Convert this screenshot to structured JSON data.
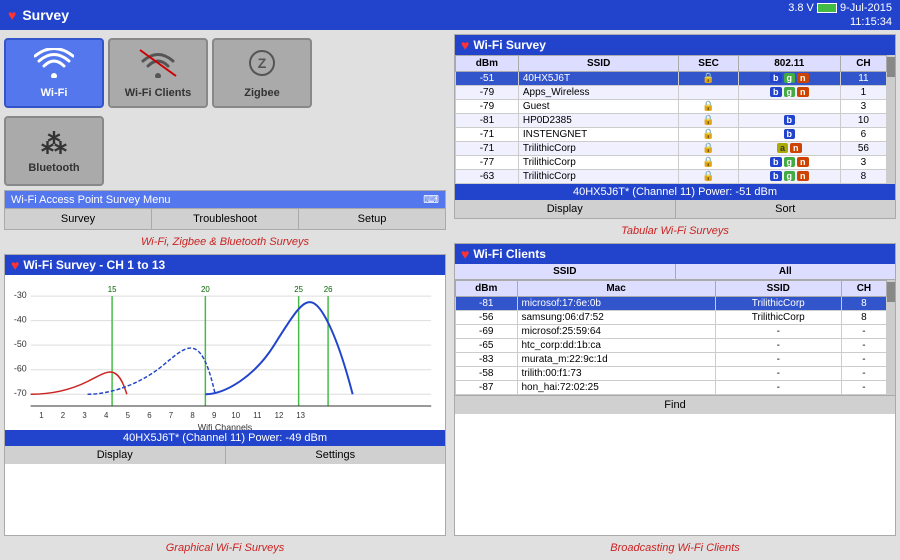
{
  "header": {
    "title": "Survey",
    "voltage": "3.8 V",
    "date": "9-Jul-2015",
    "time": "11:15:34"
  },
  "left_panel": {
    "buttons": [
      {
        "label": "Wi-Fi",
        "icon": "wifi"
      },
      {
        "label": "Wi-Fi Clients",
        "icon": "wifi-clients"
      },
      {
        "label": "Zigbee",
        "icon": "zigbee"
      }
    ],
    "bluetooth_label": "Bluetooth",
    "ap_menu": {
      "title": "Wi-Fi Access Point Survey Menu",
      "survey_btn": "Survey",
      "troubleshoot_btn": "Troubleshoot",
      "setup_btn": "Setup",
      "desc": "Wi-Fi, Zigbee & Bluetooth Surveys"
    },
    "chart": {
      "title": "Wi-Fi Survey - CH 1 to 13",
      "y_labels": [
        "-30",
        "-40",
        "-50",
        "-60",
        "-70"
      ],
      "x_label": "Wifi Channels",
      "x_ticks": [
        "1",
        "2",
        "3",
        "4",
        "5",
        "6",
        "7",
        "8",
        "9",
        "10",
        "11",
        "12",
        "13"
      ],
      "channel_markers": [
        "15",
        "20",
        "25",
        "26"
      ],
      "status_bar": "40HX5J6T* (Channel 11) Power: -49 dBm",
      "display_btn": "Display",
      "settings_btn": "Settings",
      "desc": "Graphical Wi-Fi Surveys"
    }
  },
  "right_panel": {
    "wifi_survey": {
      "title": "Wi-Fi Survey",
      "columns": [
        "dBm",
        "SSID",
        "SEC",
        "802.11",
        "CH"
      ],
      "rows": [
        {
          "dbm": "-51",
          "ssid": "40HX5J6T",
          "sec": "lock",
          "badges": [
            "b",
            "g",
            "n"
          ],
          "ch": "11",
          "selected": true
        },
        {
          "dbm": "-79",
          "ssid": "Apps_Wireless",
          "sec": "",
          "badges": [
            "b",
            "g",
            "n"
          ],
          "ch": "1"
        },
        {
          "dbm": "-79",
          "ssid": "Guest",
          "sec": "lock-green",
          "badges": [],
          "ch": "3"
        },
        {
          "dbm": "-81",
          "ssid": "HP0D2385",
          "sec": "lock-orange",
          "badges": [
            "b"
          ],
          "ch": "10"
        },
        {
          "dbm": "-71",
          "ssid": "INSTENGNET",
          "sec": "lock-green",
          "badges": [
            "b"
          ],
          "ch": "6"
        },
        {
          "dbm": "-71",
          "ssid": "TrilithicCorp",
          "sec": "lock-green",
          "badges": [
            "a",
            "n"
          ],
          "ch": "56"
        },
        {
          "dbm": "-77",
          "ssid": "TrilithicCorp",
          "sec": "lock-green",
          "badges": [
            "b",
            "g",
            "n"
          ],
          "ch": "3"
        },
        {
          "dbm": "-63",
          "ssid": "TrilithicCorp",
          "sec": "lock-green",
          "badges": [
            "b",
            "g",
            "n"
          ],
          "ch": "8"
        }
      ],
      "status_bar": "40HX5J6T* (Channel 11) Power: -51 dBm",
      "display_btn": "Display",
      "sort_btn": "Sort",
      "desc": "Tabular Wi-Fi Surveys"
    },
    "wifi_clients": {
      "title": "Wi-Fi Clients",
      "filter_ssid": "SSID",
      "filter_value": "All",
      "columns": [
        "dBm",
        "Mac",
        "SSID",
        "CH"
      ],
      "rows": [
        {
          "dbm": "-81",
          "mac": "microsof:17:6e:0b",
          "ssid": "TrilithicCorp",
          "ch": "8",
          "selected": true
        },
        {
          "dbm": "-56",
          "mac": "samsung:06:d7:52",
          "ssid": "TrilithicCorp",
          "ch": "8"
        },
        {
          "dbm": "-69",
          "mac": "microsof:25:59:64",
          "ssid": "-",
          "ch": "-"
        },
        {
          "dbm": "-65",
          "mac": "htc_corp:dd:1b:ca",
          "ssid": "-",
          "ch": "-"
        },
        {
          "dbm": "-83",
          "mac": "murata_m:22:9c:1d",
          "ssid": "-",
          "ch": "-"
        },
        {
          "dbm": "-58",
          "mac": "trilith:00:f1:73",
          "ssid": "-",
          "ch": "-"
        },
        {
          "dbm": "-87",
          "mac": "hon_hai:72:02:25",
          "ssid": "-",
          "ch": "-"
        }
      ],
      "find_btn": "Find",
      "desc": "Broadcasting Wi-Fi Clients"
    }
  }
}
